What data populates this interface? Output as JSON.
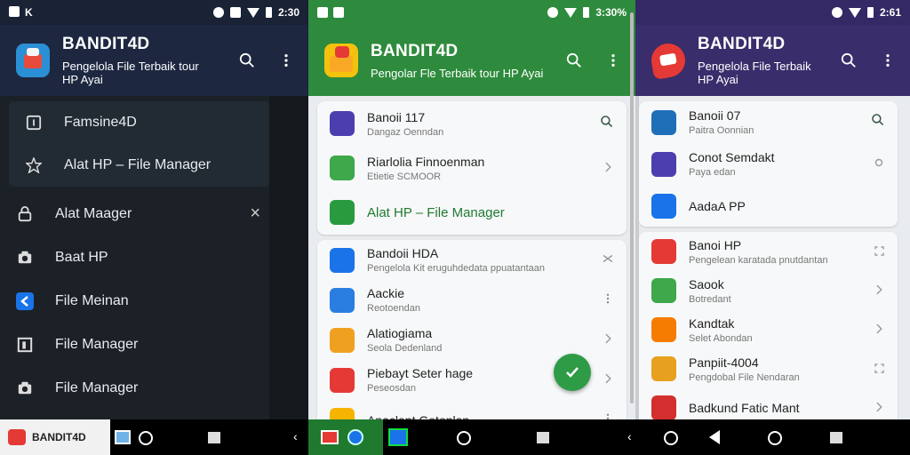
{
  "panel1": {
    "status_left": "K",
    "status_time": "2:30",
    "title": "BANDIT4D",
    "subtitle": "Pengelola File Terbaik tour HP Ayai",
    "drawer_top": [
      {
        "label": "Famsine4D",
        "icon": "info-icon"
      },
      {
        "label": "Alat HP – File Manager",
        "icon": "star-icon"
      }
    ],
    "drawer_items": [
      {
        "label": "Alat Maager",
        "icon": "lock-icon",
        "trail": "×"
      },
      {
        "label": "Baat HP",
        "icon": "camera-icon"
      },
      {
        "label": "File Meinan",
        "icon": "app-icon"
      },
      {
        "label": "File Manager",
        "icon": "square-icon"
      },
      {
        "label": "File Manager",
        "icon": "camera-icon"
      }
    ]
  },
  "panel2": {
    "status_time": "3:30%",
    "title": "BANDIT4D",
    "subtitle": "Pengolar Fle Terbaik tour HP Ayai",
    "card1": [
      {
        "title": "Banoii 117",
        "sub": "Dangaz Oenndan",
        "color": "#4b3fb0",
        "trail": "search"
      },
      {
        "title": "Riarlolia Finnoenman",
        "sub": "Etietie SCMOOR",
        "color": "#3ea84a",
        "trail": "chevron"
      },
      {
        "title": "Alat HP – File Manager",
        "sub": "",
        "color": "#2a9a3f",
        "trail": ""
      }
    ],
    "card2": [
      {
        "title": "Bandoii HDA",
        "sub": "Pengelola Kit eruguhdedata ppuatantaan",
        "color": "#1a73e8",
        "trail": "shuffle"
      },
      {
        "title": "Aackie",
        "sub": "Reotoendan",
        "color": "#2a7de1",
        "trail": "menu"
      },
      {
        "title": "Alatiogiama",
        "sub": "Seola Dedenland",
        "color": "#f0a020",
        "trail": "chevron"
      },
      {
        "title": "Piebayt Seter hage",
        "sub": "Peseosdan",
        "color": "#e53935",
        "trail": "chevron"
      },
      {
        "title": "Anaclant Getonlan",
        "sub": "",
        "color": "#f5b400",
        "trail": "menu"
      }
    ]
  },
  "panel3": {
    "status_time": "2:61",
    "title": "BANDIT4D",
    "subtitle": "Pengelola File Terbaik HP Ayai",
    "card1": [
      {
        "title": "Banoii 07",
        "sub": "Paitra Oonnian",
        "color": "#1e6fb8",
        "trail": "search"
      },
      {
        "title": "Conot Semdakt",
        "sub": "Paya edan",
        "color": "#4b3fb0",
        "trail": "circle"
      },
      {
        "title": "AadaA PP",
        "sub": "",
        "color": "#1a73e8",
        "trail": ""
      }
    ],
    "card2": [
      {
        "title": "Banoi HP",
        "sub": "Pengelean karatada pnutdantan",
        "color": "#e53935",
        "trail": "expand"
      },
      {
        "title": "Saook",
        "sub": "Botredant",
        "color": "#3ea84a",
        "trail": "chevron"
      },
      {
        "title": "Kandtak",
        "sub": "Selet Abondan",
        "color": "#f57c00",
        "trail": "chevron"
      },
      {
        "title": "Panpiit-4004",
        "sub": "Pengdobal File Nendaran",
        "color": "#e8a020",
        "trail": "expand"
      },
      {
        "title": "Badkund Fatic Mant",
        "sub": "",
        "color": "#d32f2f",
        "trail": "chevron"
      }
    ]
  },
  "navbar": {
    "brand": "BANDIT4D"
  }
}
